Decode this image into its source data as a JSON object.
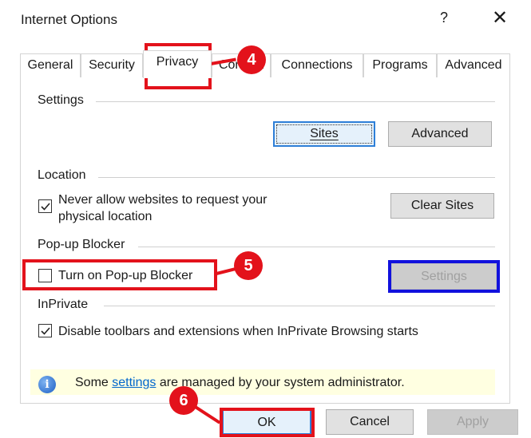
{
  "window": {
    "title": "Internet Options",
    "help_glyph": "?",
    "close_glyph": "✕"
  },
  "tabs": [
    {
      "label": "General"
    },
    {
      "label": "Security"
    },
    {
      "label": "Privacy",
      "active": true
    },
    {
      "label": "Content"
    },
    {
      "label": "Connections"
    },
    {
      "label": "Programs"
    },
    {
      "label": "Advanced"
    }
  ],
  "settings_group": {
    "title": "Settings",
    "sites_button": "Sites",
    "advanced_button": "Advanced"
  },
  "location_group": {
    "title": "Location",
    "checkbox_line1": "Never allow websites to request your",
    "checkbox_line2": "physical location",
    "checked": true,
    "clear_sites_button": "Clear Sites"
  },
  "popup_group": {
    "title": "Pop-up Blocker",
    "checkbox_label": "Turn on Pop-up Blocker",
    "checked": false,
    "settings_button": "Settings",
    "settings_disabled": true
  },
  "inprivate_group": {
    "title": "InPrivate",
    "checkbox_label": "Disable toolbars and extensions when InPrivate Browsing starts",
    "checked": true
  },
  "infobar": {
    "before": "Some ",
    "link": "settings",
    "after": " are managed by your system administrator."
  },
  "footer": {
    "ok": "OK",
    "cancel": "Cancel",
    "apply": "Apply"
  },
  "annotations": {
    "marker4": "4",
    "marker5": "5",
    "marker6": "6",
    "highlight_color": "#e3121b",
    "secondary_highlight_color": "#1111dd"
  }
}
